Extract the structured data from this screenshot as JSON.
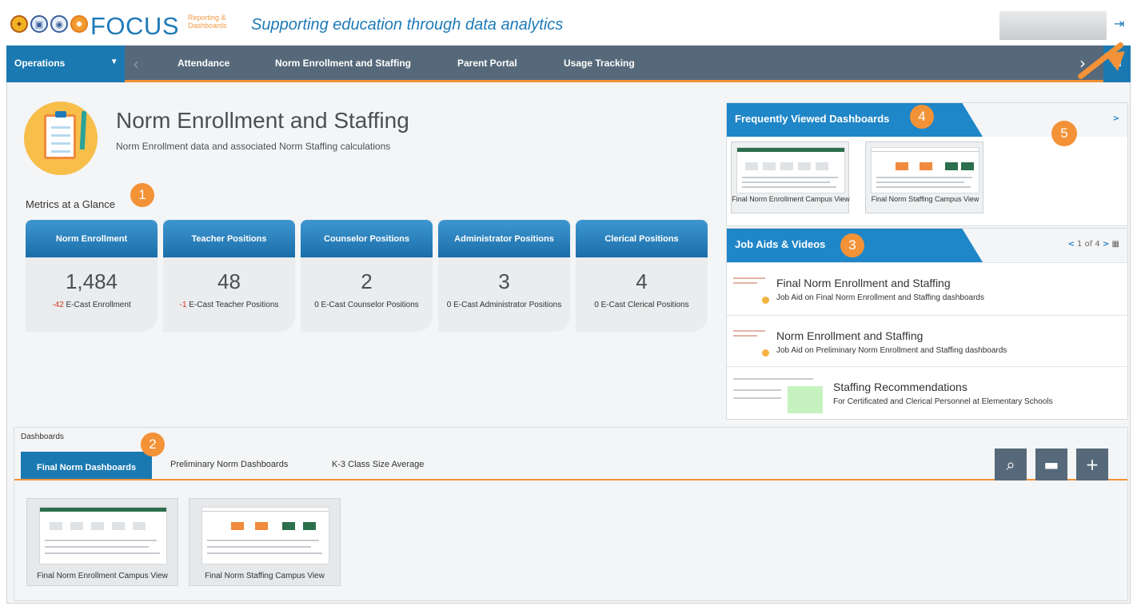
{
  "header": {
    "brand": "FOCUS",
    "brand_sub": "Reporting & Dashboards",
    "tagline": "Supporting education through data analytics"
  },
  "nav": {
    "section": "Operations",
    "items": [
      {
        "label": "Attendance"
      },
      {
        "label": "Norm Enrollment and Staffing"
      },
      {
        "label": "Parent Portal"
      },
      {
        "label": "Usage Tracking"
      }
    ]
  },
  "page": {
    "title": "Norm Enrollment and Staffing",
    "subtitle": "Norm Enrollment data and associated Norm Staffing calculations",
    "metrics_label": "Metrics at a Glance"
  },
  "metrics": [
    {
      "title": "Norm Enrollment",
      "value": "1,484",
      "delta": "-42",
      "note": "E-Cast Enrollment"
    },
    {
      "title": "Teacher Positions",
      "value": "48",
      "delta": "-1",
      "note": "E-Cast Teacher Positions"
    },
    {
      "title": "Counselor Positions",
      "value": "2",
      "delta": "0",
      "note": "E-Cast Counselor Positions"
    },
    {
      "title": "Administrator Positions",
      "value": "3",
      "delta": "0",
      "note": "E-Cast Administrator Positions"
    },
    {
      "title": "Clerical Positions",
      "value": "4",
      "delta": "0",
      "note": "E-Cast Clerical Positions"
    }
  ],
  "frequent": {
    "title": "Frequently Viewed Dashboards",
    "thumbs": [
      {
        "caption": "Final Norm Enrollment Campus View"
      },
      {
        "caption": "Final Norm Staffing Campus View"
      }
    ]
  },
  "job_aids": {
    "title": "Job Aids & Videos",
    "pager": "1 of 4",
    "items": [
      {
        "title": "Final Norm Enrollment and Staffing",
        "desc": "Job Aid on Final Norm Enrollment and Staffing dashboards"
      },
      {
        "title": "Norm Enrollment and Staffing",
        "desc": "Job Aid on Preliminary Norm Enrollment and Staffing dashboards"
      },
      {
        "title": "Staffing Recommendations",
        "desc": "For Certificated and Clerical Personnel at Elementary Schools"
      }
    ]
  },
  "dashboards": {
    "label": "Dashboards",
    "tabs": [
      {
        "label": "Final Norm Dashboards"
      },
      {
        "label": "Preliminary Norm Dashboards"
      },
      {
        "label": "K-3 Class Size Average"
      }
    ],
    "thumbs": [
      {
        "caption": "Final Norm Enrollment Campus View"
      },
      {
        "caption": "Final Norm Staffing Campus View"
      }
    ]
  },
  "callouts": [
    "1",
    "2",
    "3",
    "4",
    "5"
  ],
  "colors": {
    "accent": "#f39237",
    "primary": "#1b79b2",
    "nav": "#56697a",
    "negative": "#d9341e"
  }
}
